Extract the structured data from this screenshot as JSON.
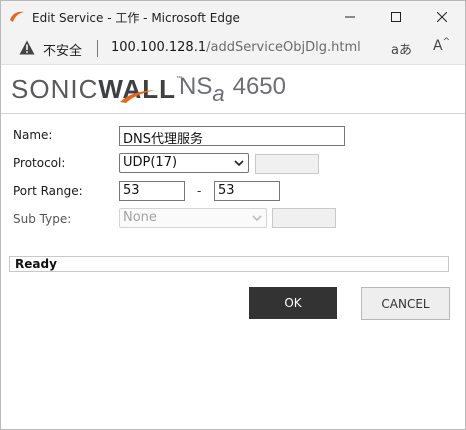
{
  "window": {
    "title": "Edit Service - 工作 - Microsoft Edge"
  },
  "address_bar": {
    "security_label": "不安全",
    "url_host": "100.100.128.1",
    "url_path": "/addServiceObjDlg.html",
    "read_aloud_label": "aあ",
    "font_icon_label": "A",
    "font_icon_sup": "^"
  },
  "header": {
    "brand_part1": "SONIC",
    "brand_part2": "WALL",
    "trademark": "™",
    "model_prefix": "NS",
    "model_sub": "a",
    "model_number": "4650"
  },
  "form": {
    "name": {
      "label": "Name:",
      "value": "DNS代理服务"
    },
    "protocol": {
      "label": "Protocol:",
      "value": "UDP(17)",
      "extra_value": ""
    },
    "port_range": {
      "label": "Port Range:",
      "from": "53",
      "separator": "-",
      "to": "53"
    },
    "sub_type": {
      "label": "Sub Type:",
      "value": "None",
      "extra_value": ""
    }
  },
  "status": {
    "text": "Ready"
  },
  "buttons": {
    "ok": "OK",
    "cancel": "CANCEL"
  },
  "colors": {
    "brand_orange": "#e8651a",
    "ok_button": "#333333",
    "cancel_button": "#eeeeee"
  }
}
